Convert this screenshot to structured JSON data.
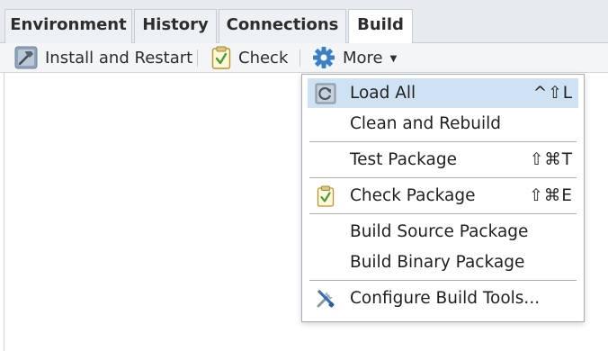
{
  "tabs": [
    {
      "label": "Environment"
    },
    {
      "label": "History"
    },
    {
      "label": "Connections"
    },
    {
      "label": "Build",
      "active": true
    }
  ],
  "toolbar": {
    "install_label": "Install and Restart",
    "check_label": "Check",
    "more_label": "More"
  },
  "menu": {
    "items": [
      {
        "label": "Load All",
        "shortcut": "^⇧L",
        "icon": "reload-icon",
        "highlighted": true
      },
      {
        "label": "Clean and Rebuild",
        "shortcut": ""
      },
      {
        "label": "Test Package",
        "shortcut": "⇧⌘T"
      },
      {
        "label": "Check Package",
        "shortcut": "⇧⌘E",
        "icon": "clipboard-check-icon"
      },
      {
        "label": "Build Source Package",
        "shortcut": ""
      },
      {
        "label": "Build Binary Package",
        "shortcut": ""
      },
      {
        "label": "Configure Build Tools...",
        "shortcut": "",
        "icon": "tools-icon"
      }
    ]
  },
  "colors": {
    "tabstrip_bg": "#e7ebef",
    "toolbar_bg": "#f3f5f7",
    "highlight": "#cfe2f3",
    "gear_blue": "#3b7fc4",
    "check_green": "#4a9a3a"
  }
}
